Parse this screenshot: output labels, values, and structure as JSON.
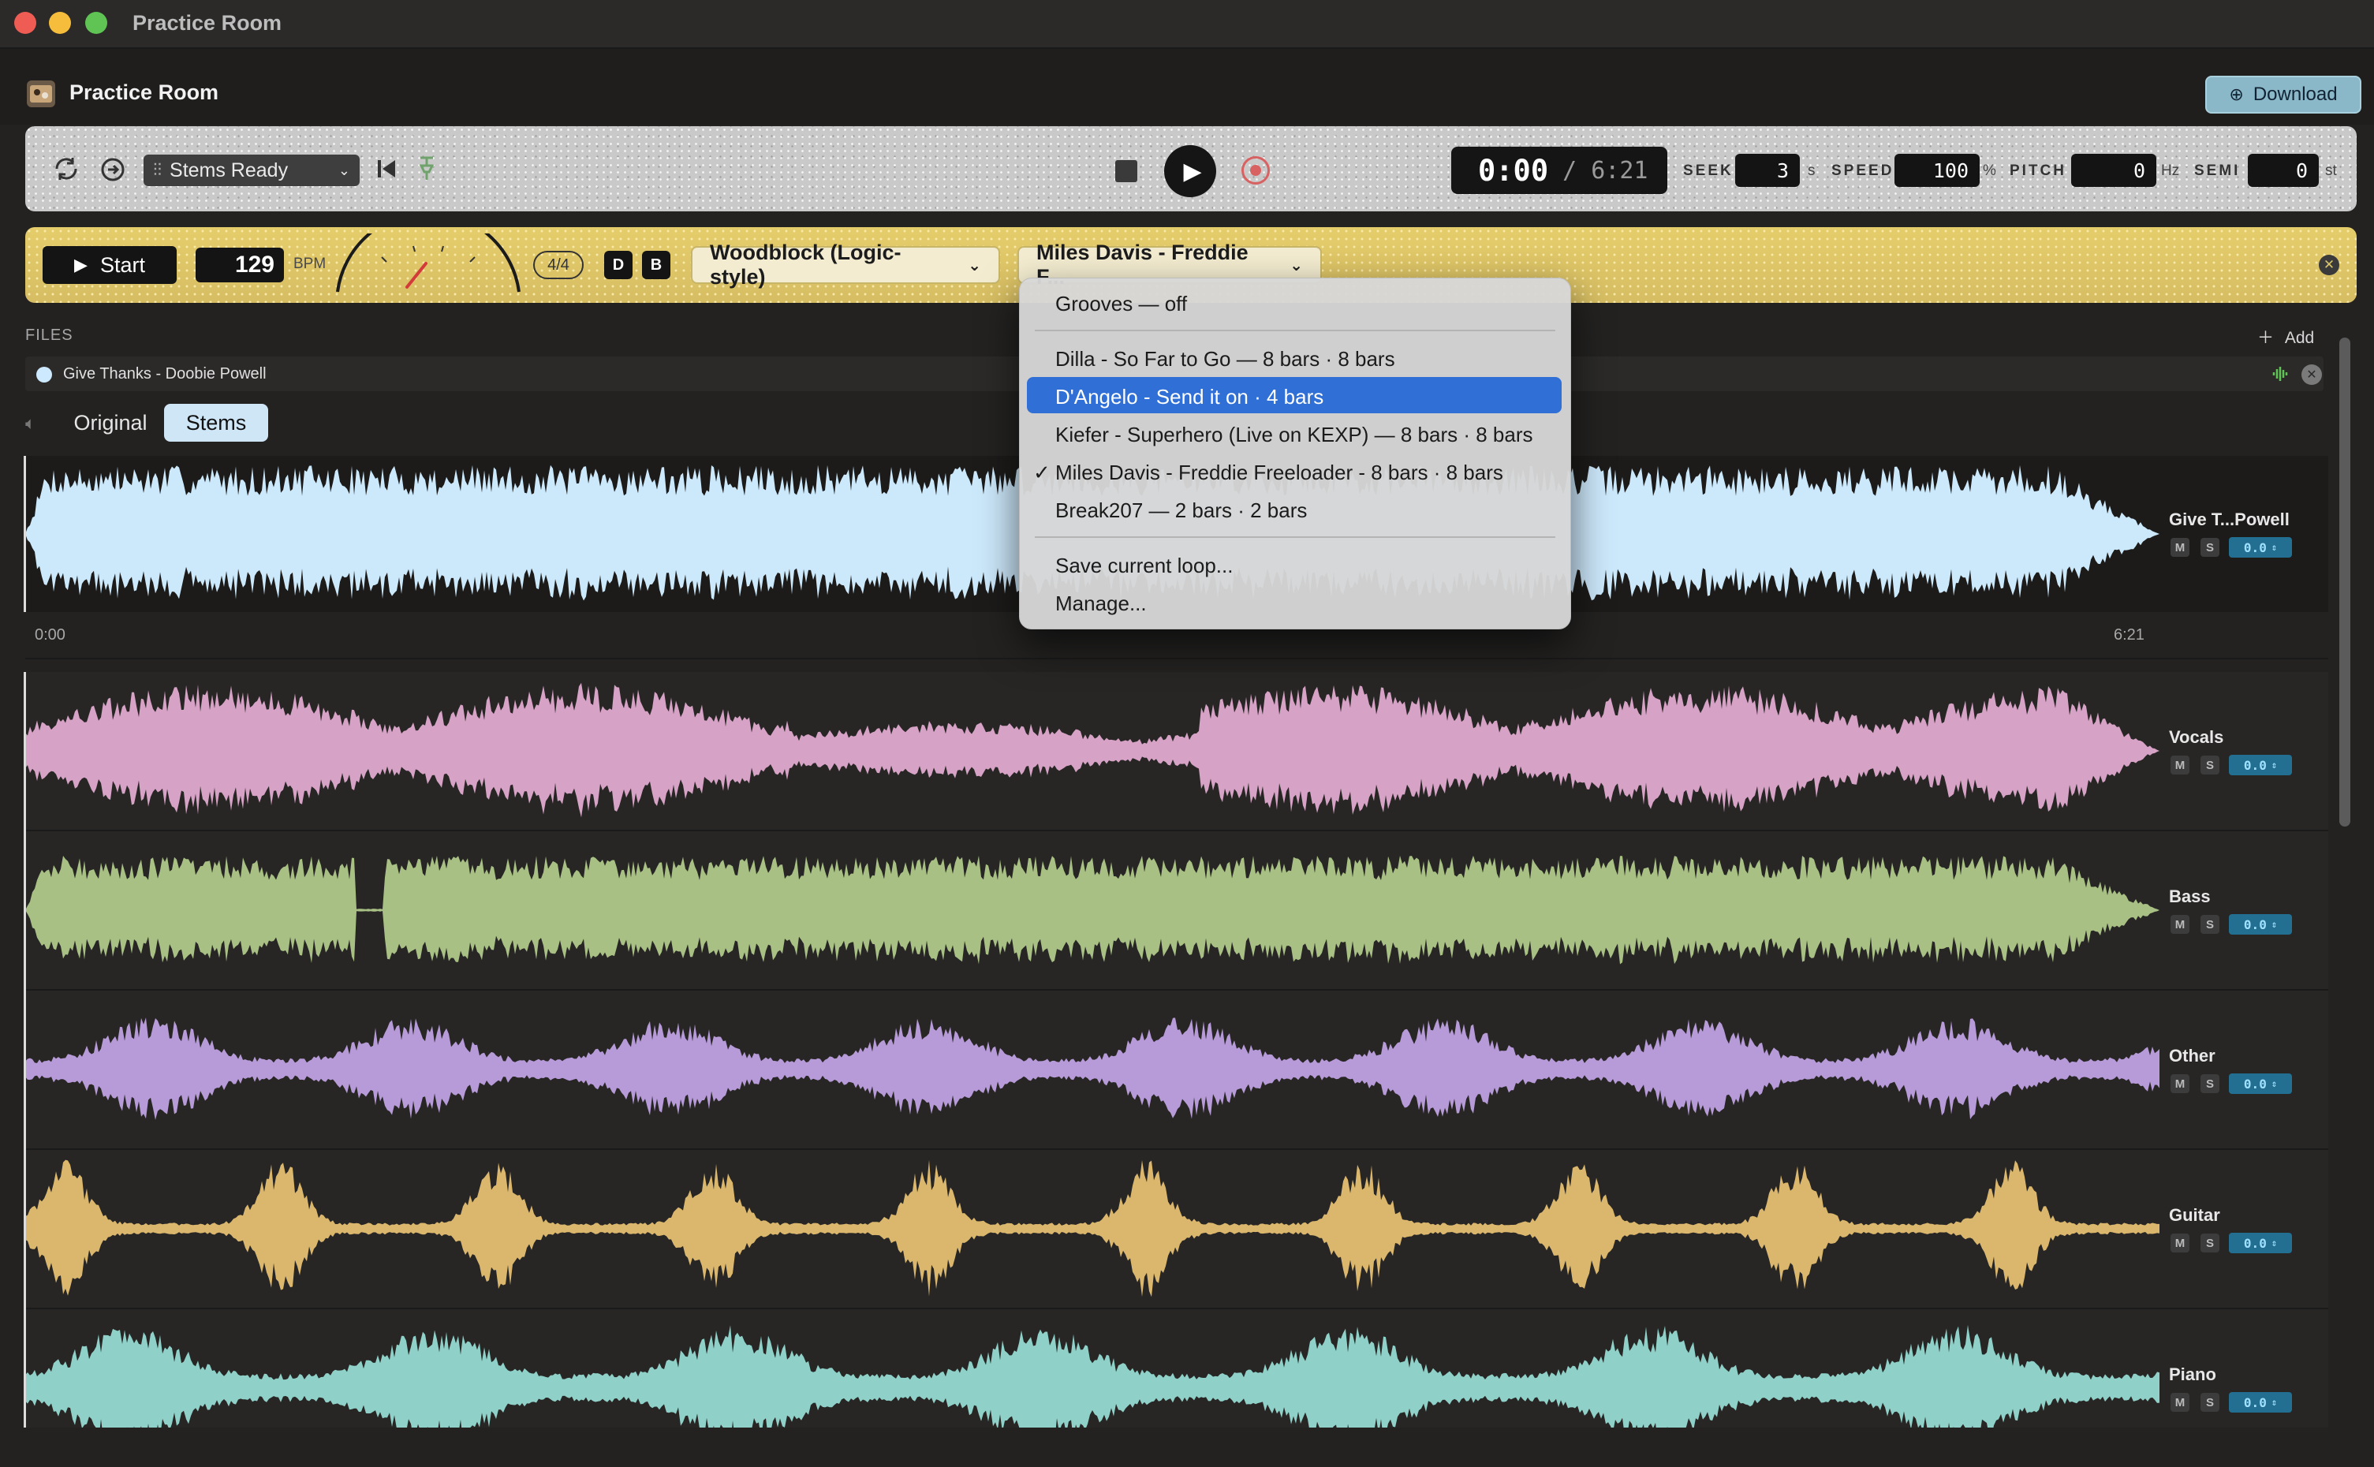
{
  "window": {
    "title": "Practice Room"
  },
  "header": {
    "app_title": "Practice Room",
    "download_label": "Download"
  },
  "transport": {
    "stems_select": "Stems Ready",
    "time_current": "0:00",
    "time_total": "/ 6:21",
    "seek_label": "SEEK",
    "seek_value": "3",
    "seek_unit": "s",
    "speed_label": "SPEED",
    "speed_value": "100",
    "speed_unit": "%",
    "pitch_label": "PITCH",
    "pitch_value": "0",
    "pitch_unit": "Hz",
    "semi_label": "SEMI",
    "semi_value": "0",
    "semi_unit": "st"
  },
  "metronome": {
    "start_label": "Start",
    "bpm_value": "129",
    "bpm_label": "BPM",
    "time_signature": "4/4",
    "d_label": "D",
    "b_label": "B",
    "sound_select": "Woodblock (Logic-style)",
    "groove_select": "Miles Davis - Freddie F..."
  },
  "groove_menu": {
    "items": [
      "Grooves — off",
      "Dilla - So Far to Go — 8 bars · 8 bars",
      "D'Angelo - Send it on · 4 bars",
      "Kiefer - Superhero (Live on KEXP) — 8 bars · 8 bars",
      "Miles Davis - Freddie Freeloader - 8 bars · 8 bars",
      "Break207 — 2 bars · 2 bars",
      "Save current loop...",
      "Manage..."
    ],
    "highlighted_index": 2,
    "checked_index": 4,
    "check_mark": "✓"
  },
  "files": {
    "label": "FILES",
    "add_label": "Add",
    "items": [
      {
        "name": "Give Thanks - Doobie Powell"
      }
    ]
  },
  "view_tabs": {
    "original": "Original",
    "stems": "Stems",
    "active": "stems"
  },
  "timeline": {
    "start": "0:00",
    "end": "6:21"
  },
  "tracks": [
    {
      "name": "Give T...Powell",
      "color": "#cce8fb",
      "mute": "M",
      "solo": "S",
      "volume": "0.0"
    },
    {
      "name": "Vocals",
      "color": "#d6a2c5",
      "mute": "M",
      "solo": "S",
      "volume": "0.0"
    },
    {
      "name": "Bass",
      "color": "#a8c084",
      "mute": "M",
      "solo": "S",
      "volume": "0.0"
    },
    {
      "name": "Other",
      "color": "#b79ad8",
      "mute": "M",
      "solo": "S",
      "volume": "0.0"
    },
    {
      "name": "Guitar",
      "color": "#dbb76e",
      "mute": "M",
      "solo": "S",
      "volume": "0.0"
    },
    {
      "name": "Piano",
      "color": "#8fd1c8",
      "mute": "M",
      "solo": "S",
      "volume": "0.0"
    }
  ],
  "colors": {
    "accent_blue": "#2f6fd6",
    "metronome_yellow": "#e3ca69",
    "download_button": "#8ab8c8",
    "volume_badge": "#226f92"
  }
}
